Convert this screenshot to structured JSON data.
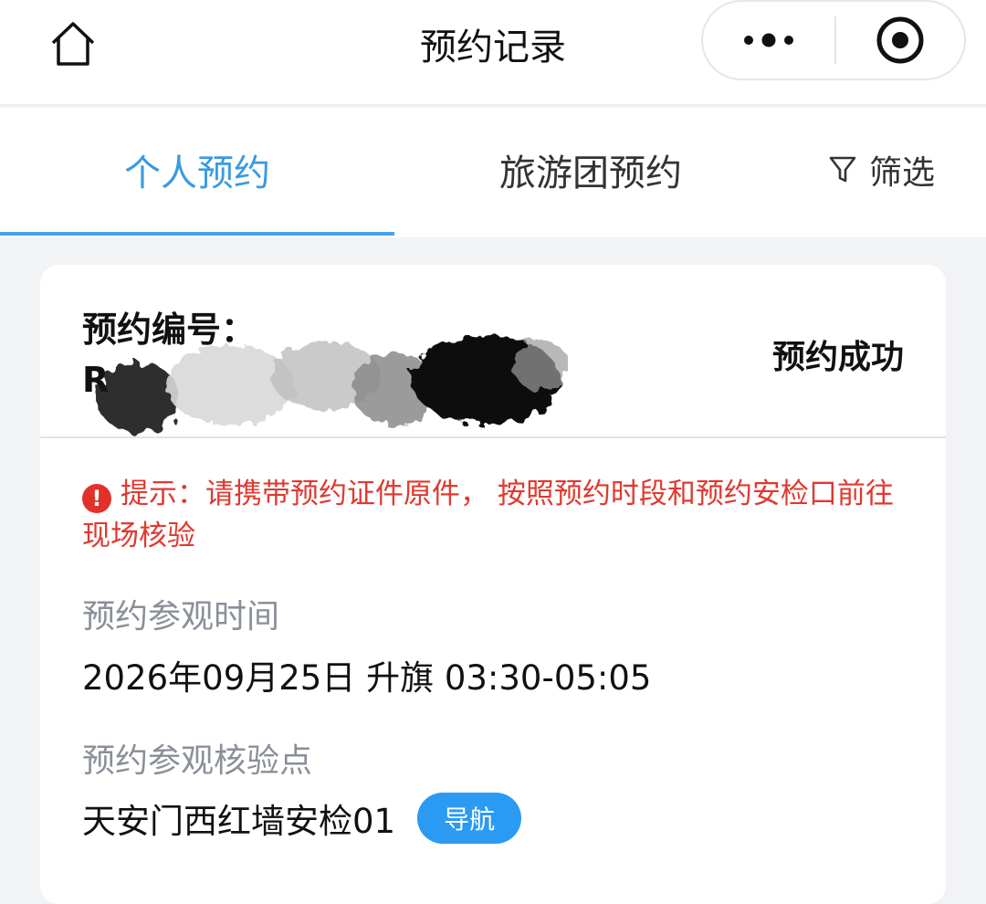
{
  "header": {
    "title": "预约记录",
    "home_icon": "home-icon",
    "more_icon": "more-dots-icon",
    "close_icon": "target-circle-icon"
  },
  "tabs": {
    "personal": "个人预约",
    "group": "旅游团预约",
    "filter": "筛选",
    "active": "personal",
    "accent_color": "#3a9ae0"
  },
  "card": {
    "reservation_label": "预约编号：",
    "reservation_number": "R",
    "status": "预约成功",
    "notice": "提示：请携带预约证件原件， 按照预约时段和预约安检口前往现场核验",
    "visit_time_label": "预约参观时间",
    "visit_time_value": "2026年09月25日 升旗 03:30-05:05",
    "checkpoint_label": "预约参观核验点",
    "checkpoint_value": "天安门西红墙安检01",
    "navigate_button": "导航",
    "notice_color": "#e0392f",
    "button_color": "#2a9af3"
  }
}
